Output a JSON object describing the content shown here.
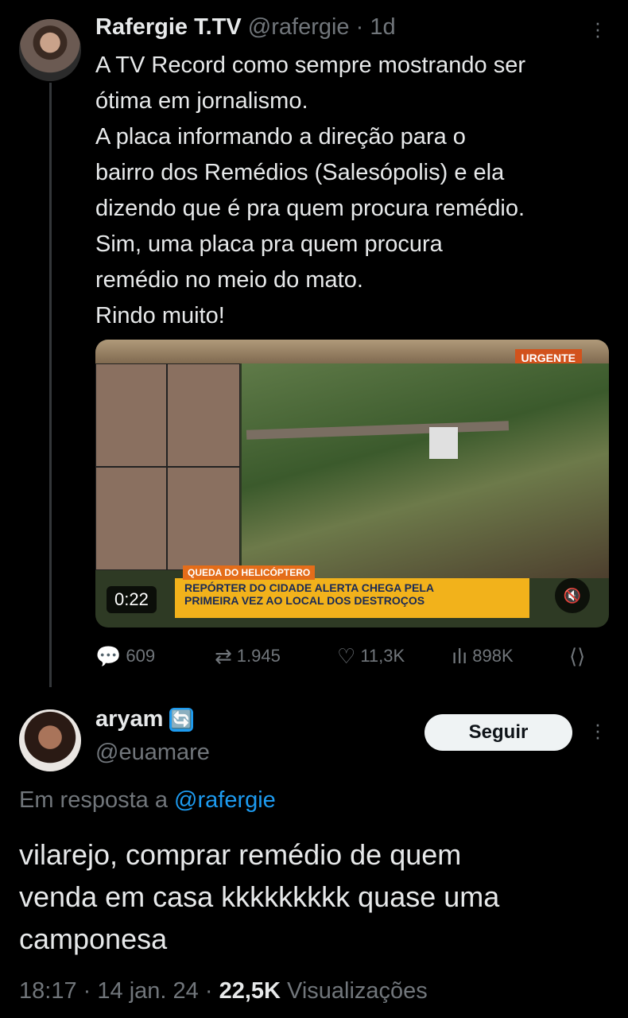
{
  "tweet": {
    "display_name": "Rafergie T.TV",
    "handle": "@rafergie",
    "separator": "·",
    "time_ago": "1d",
    "text_lines": [
      "A TV Record como sempre mostrando ser",
      "ótima em jornalismo.",
      "A placa informando a direção para o",
      "bairro dos Remédios (Salesópolis) e ela",
      "dizendo que é pra quem procura remédio.",
      "Sim, uma placa pra quem procura",
      "remédio no meio do mato.",
      "Rindo muito!"
    ],
    "media": {
      "duration": "0:22",
      "urgent_tag": "URGENTE",
      "segment_tag": "QUEDA DO HELICÓPTERO",
      "caption_line1": "REPÓRTER DO CIDADE ALERTA CHEGA PELA",
      "caption_line2": "PRIMEIRA VEZ AO LOCAL DOS DESTROÇOS"
    },
    "stats": {
      "replies": "609",
      "retweets": "1.945",
      "likes": "11,3K",
      "views": "898K"
    }
  },
  "reply": {
    "display_name": "aryam",
    "handle": "@euamare",
    "badge_icon": "🔄",
    "follow_label": "Seguir",
    "reply_prefix": "Em resposta a",
    "reply_target": "@rafergie",
    "text_lines": [
      "vilarejo, comprar remédio de quem",
      "venda em casa kkkkkkkkk quase uma",
      "camponesa"
    ],
    "time": "18:17",
    "date": "14 jan. 24",
    "views_count": "22,5K",
    "views_label": "Visualizações"
  },
  "icons": {
    "reply": "reply-icon",
    "retweet": "retweet-icon",
    "like": "heart-icon",
    "views": "views-icon",
    "share": "share-icon",
    "more": "more-icon"
  },
  "colors": {
    "background": "#000000",
    "text": "#e7e9ea",
    "muted": "#71767b",
    "link": "#1d9bf0",
    "follow_button": "#eff3f4"
  }
}
